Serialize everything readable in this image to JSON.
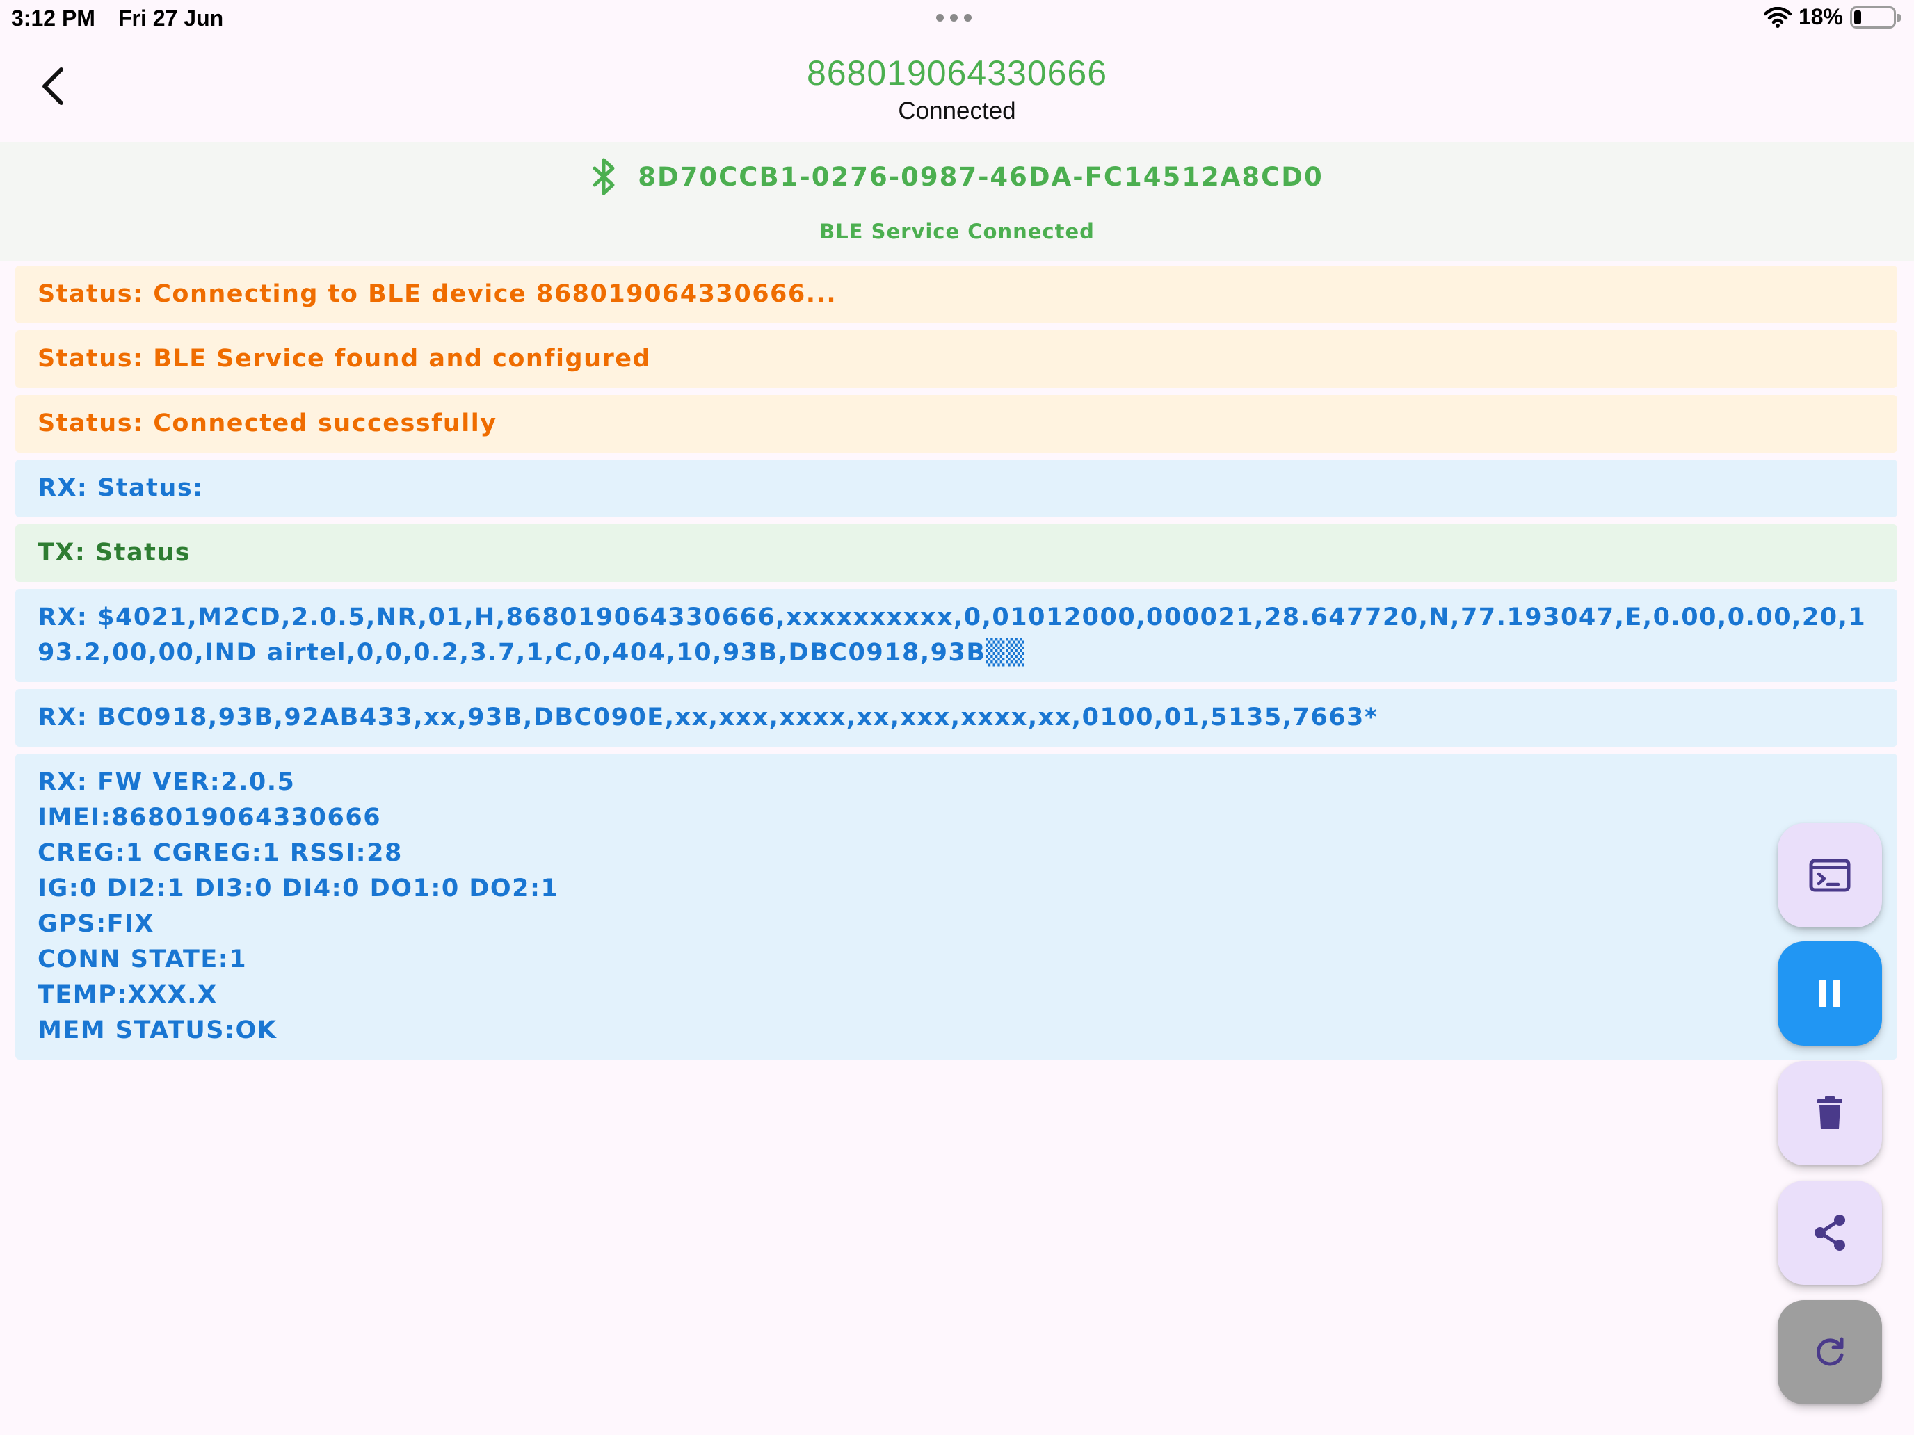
{
  "status_bar": {
    "time": "3:12 PM",
    "date": "Fri 27 Jun",
    "battery": "18%",
    "battery_level": 0.18,
    "icons": [
      "wifi-icon",
      "battery-icon",
      "multitasking-dots-icon"
    ]
  },
  "header": {
    "device_id": "868019064330666",
    "connection_state": "Connected",
    "back_icon": "chevron-left-icon"
  },
  "ble": {
    "uuid": "8D70CCB1-0276-0987-46DA-FC14512A8CD0",
    "service_state": "BLE Service Connected",
    "icon": "bluetooth-icon"
  },
  "log": [
    {
      "kind": "status",
      "text": "Status: Connecting to BLE device 868019064330666..."
    },
    {
      "kind": "status",
      "text": "Status: BLE Service found and configured"
    },
    {
      "kind": "status",
      "text": "Status: Connected successfully"
    },
    {
      "kind": "rx",
      "text": "RX: Status:"
    },
    {
      "kind": "tx",
      "text": "TX: Status"
    },
    {
      "kind": "rx",
      "text": "RX: $4021,M2CD,2.0.5,NR,01,H,868019064330666,xxxxxxxxxx,0,01012000,000021,28.647720,N,77.193047,E,0.00,0.00,20,193.2,00,00,IND airtel,0,0,0.2,3.7,1,C,0,404,10,93B,DBC0918,93B▒▒"
    },
    {
      "kind": "rx",
      "text": "RX: BC0918,93B,92AB433,xx,93B,DBC090E,xx,xxx,xxxx,xx,xxx,xxxx,xx,0100,01,5135,7663*"
    },
    {
      "kind": "rx",
      "text": "RX: FW VER:2.0.5\nIMEI:868019064330666\nCREG:1 CGREG:1 RSSI:28\nIG:0 DI2:1 DI3:0 DI4:0 DO1:0 DO2:1\nGPS:FIX\nCONN STATE:1\nTEMP:XXX.X\nMEM STATUS:OK"
    }
  ],
  "fabs": [
    {
      "name": "terminal-button",
      "icon": "terminal-icon"
    },
    {
      "name": "pause-button",
      "icon": "pause-icon"
    },
    {
      "name": "delete-button",
      "icon": "trash-icon"
    },
    {
      "name": "share-button",
      "icon": "share-icon"
    },
    {
      "name": "refresh-button",
      "icon": "refresh-icon"
    }
  ],
  "colors": {
    "accent_green": "#4caf50",
    "status_orange": "#ef6c00",
    "status_bg": "#fff3e0",
    "rx_blue": "#1976d2",
    "rx_bg": "#e3f2fc",
    "tx_green": "#2e7d32",
    "tx_bg": "#e8f5e9",
    "fab_primary": "#2196f3",
    "fab_light": "#eadffa",
    "fab_icon": "#4a3a8a",
    "fab_grey": "#9e9e9e"
  }
}
